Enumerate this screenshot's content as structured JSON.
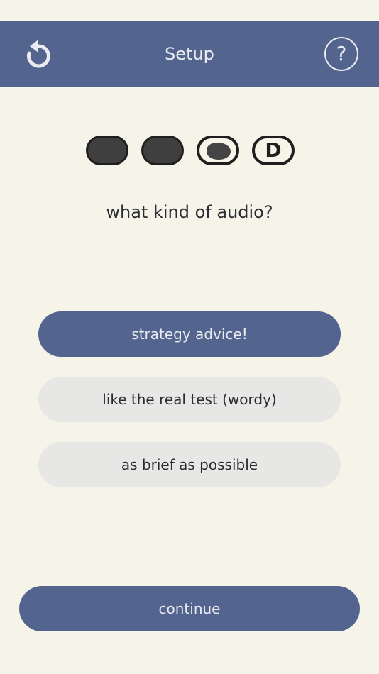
{
  "header": {
    "title": "Setup",
    "help_label": "?",
    "undo_icon": "undo-icon",
    "background_color": "#53648e"
  },
  "progress": {
    "steps": [
      {
        "state": "filled"
      },
      {
        "state": "filled"
      },
      {
        "state": "scribbled"
      },
      {
        "state": "letter",
        "label": "D"
      }
    ]
  },
  "question": "what kind of audio?",
  "options": [
    {
      "label": "strategy advice!",
      "selected": true
    },
    {
      "label": "like the real test (wordy)",
      "selected": false
    },
    {
      "label": "as brief as possible",
      "selected": false
    }
  ],
  "continue_label": "continue",
  "colors": {
    "accent": "#53648e",
    "background": "#f6f4e8",
    "option_unselected": "#e7e7e6"
  }
}
